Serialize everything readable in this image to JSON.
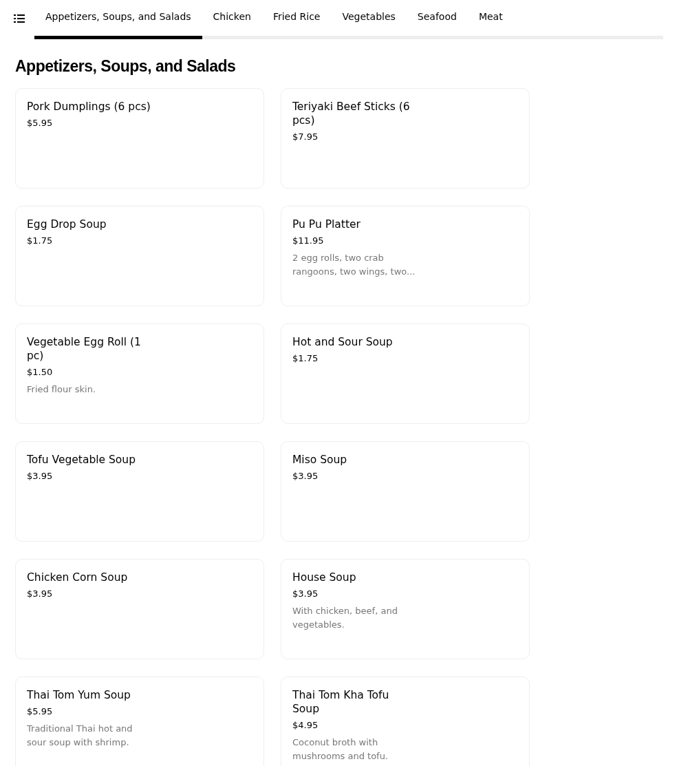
{
  "tabs": [
    {
      "label": "Appetizers, Soups, and Salads",
      "selected": true
    },
    {
      "label": "Chicken",
      "selected": false
    },
    {
      "label": "Fried Rice",
      "selected": false
    },
    {
      "label": "Vegetables",
      "selected": false
    },
    {
      "label": "Seafood",
      "selected": false
    },
    {
      "label": "Meat",
      "selected": false
    }
  ],
  "section_title": "Appetizers, Soups, and Salads",
  "items": [
    {
      "name": "Pork Dumplings (6 pcs)",
      "price": "$5.95"
    },
    {
      "name": "Teriyaki Beef Sticks (6 pcs)",
      "price": "$7.95"
    },
    {
      "name": "Egg Drop Soup",
      "price": "$1.75"
    },
    {
      "name": "Pu Pu Platter",
      "price": "$11.95",
      "description": "2 egg rolls, two crab rangoons, two wings, two..."
    },
    {
      "name": "Vegetable Egg Roll (1 pc)",
      "price": "$1.50",
      "description": "Fried flour skin."
    },
    {
      "name": "Hot and Sour Soup",
      "price": "$1.75"
    },
    {
      "name": "Tofu Vegetable Soup",
      "price": "$3.95"
    },
    {
      "name": "Miso Soup",
      "price": "$3.95"
    },
    {
      "name": "Chicken Corn Soup",
      "price": "$3.95"
    },
    {
      "name": "House Soup",
      "price": "$3.95",
      "description": "With chicken, beef, and vegetables."
    },
    {
      "name": "Thai Tom Yum Soup",
      "price": "$5.95",
      "description": "Traditional Thai hot and sour soup with shrimp."
    },
    {
      "name": "Thai Tom Kha Tofu Soup",
      "price": "$4.95",
      "description": "Coconut broth with mushrooms and tofu."
    }
  ]
}
